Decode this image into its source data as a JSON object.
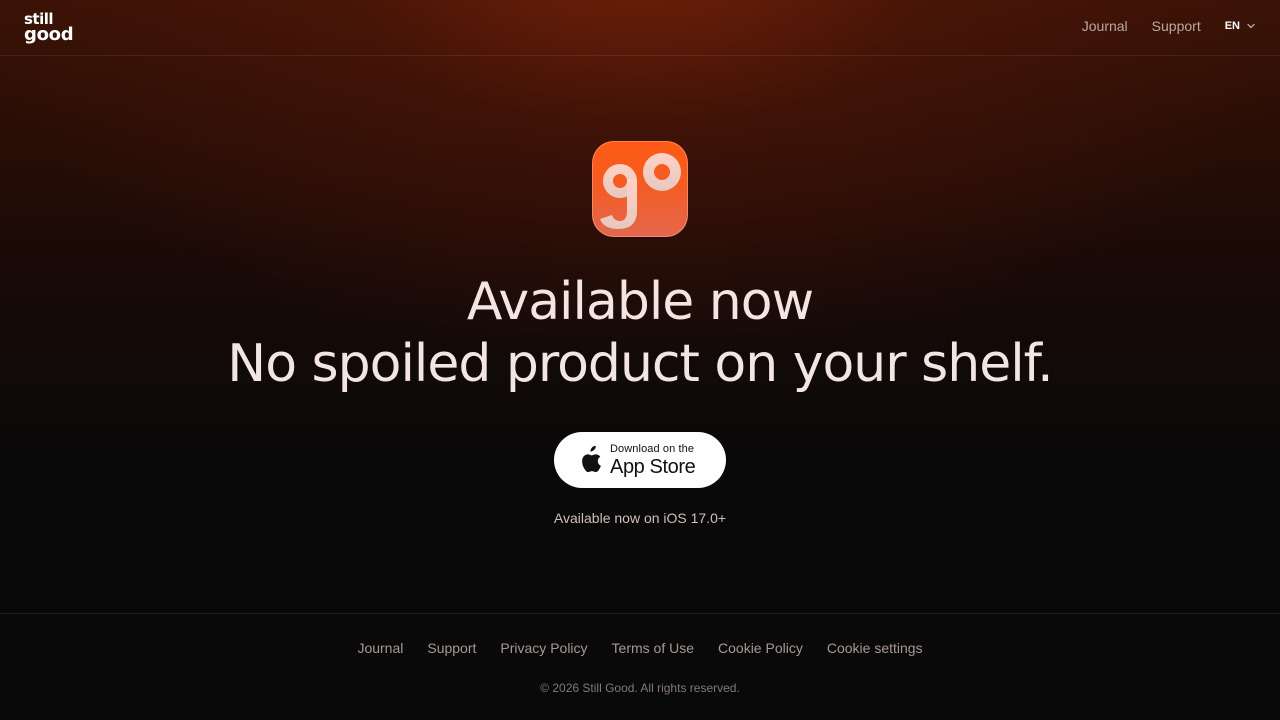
{
  "brand": {
    "line1": "still",
    "line2": "good"
  },
  "nav": {
    "links": [
      "Journal",
      "Support"
    ],
    "language": "EN"
  },
  "hero": {
    "title_line1": "Available now",
    "title_line2": "No spoiled product on your shelf.",
    "icon_letters": "go",
    "icon_color": "#ff5a14",
    "store_button": {
      "small": "Download on the",
      "big": "App Store"
    },
    "note": "Available now on iOS 17.0+"
  },
  "footer": {
    "links": [
      "Journal",
      "Support",
      "Privacy Policy",
      "Terms of Use",
      "Cookie Policy",
      "Cookie settings"
    ],
    "copyright": "© 2026 Still Good. All rights reserved."
  }
}
